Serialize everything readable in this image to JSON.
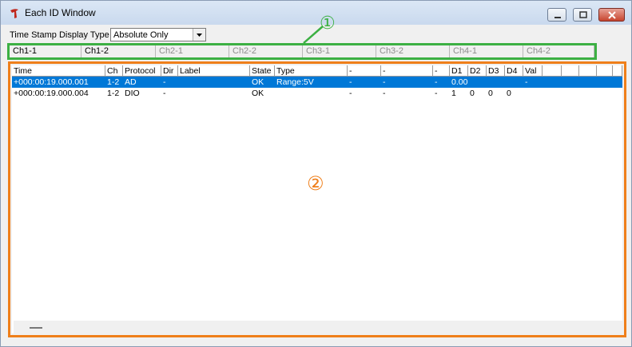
{
  "window": {
    "title": "Each ID Window",
    "app_icon": "red-figure-icon"
  },
  "toolbar": {
    "timestamp_label": "Time Stamp Display Type",
    "timestamp_value": "Absolute Only"
  },
  "annotations": {
    "one": "①",
    "two": "②",
    "green": "#3cb043",
    "orange": "#ef7f1a"
  },
  "tabs": [
    {
      "label": "Ch1-1",
      "active": true
    },
    {
      "label": "Ch1-2",
      "active": true
    },
    {
      "label": "Ch2-1",
      "active": false
    },
    {
      "label": "Ch2-2",
      "active": false
    },
    {
      "label": "Ch3-1",
      "active": false
    },
    {
      "label": "Ch3-2",
      "active": false
    },
    {
      "label": "Ch4-1",
      "active": false
    },
    {
      "label": "Ch4-2",
      "active": false
    }
  ],
  "table": {
    "columns": [
      "Time",
      "Ch",
      "Protocol",
      "Dir",
      "Label",
      "State",
      "Type",
      "-",
      "-",
      "-",
      "D1",
      "D2",
      "D3",
      "D4",
      "Val",
      "",
      "",
      "",
      "",
      ""
    ],
    "rows": [
      {
        "selected": true,
        "cells": [
          "+000:00:19.000.001",
          "1-2",
          "AD",
          "-",
          "",
          "OK",
          "Range:5V",
          "-",
          "-",
          "-",
          "0.001",
          "",
          "",
          "",
          "-",
          "",
          "",
          "",
          "",
          ""
        ]
      },
      {
        "selected": false,
        "cells": [
          "+000:00:19.000.004",
          "1-2",
          "DIO",
          "-",
          "",
          "OK",
          "",
          "-",
          "-",
          "-",
          "1",
          "0",
          "0",
          "0",
          "",
          "",
          "",
          "",
          "",
          ""
        ]
      }
    ]
  },
  "colors": {
    "selection": "#0078d7",
    "title_bg": "#dbe7f5",
    "close_btn": "#c7452f"
  }
}
